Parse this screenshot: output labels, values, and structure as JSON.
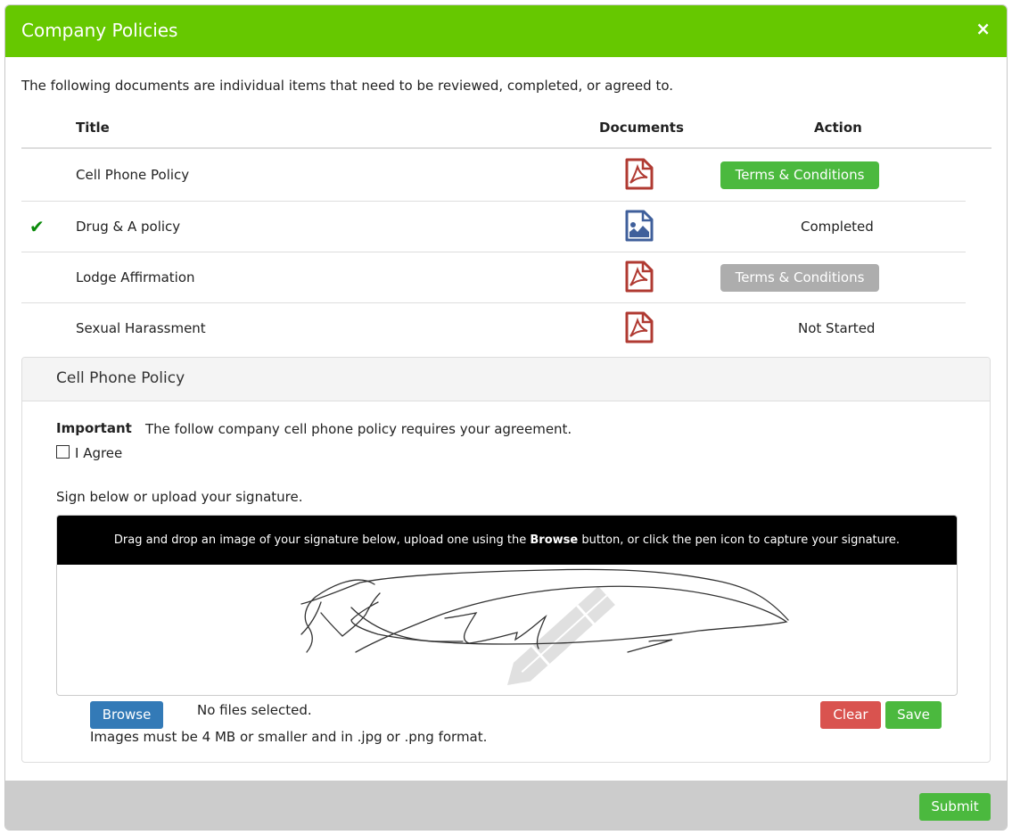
{
  "modal": {
    "title": "Company Policies",
    "close_label": "×",
    "intro": "The following documents are individual items that need to be reviewed, completed, or agreed to.",
    "table": {
      "headers": {
        "title": "Title",
        "documents": "Documents",
        "action": "Action"
      },
      "rows": [
        {
          "title": "Cell Phone Policy",
          "completed": false,
          "doc_icon": "pdf-icon",
          "action_type": "button-active",
          "action": "Terms & Conditions"
        },
        {
          "title": "Drug & A policy",
          "completed": true,
          "doc_icon": "image-file-icon",
          "action_type": "text",
          "action": "Completed"
        },
        {
          "title": "Lodge Affirmation",
          "completed": false,
          "doc_icon": "pdf-icon",
          "action_type": "button-disabled",
          "action": "Terms & Conditions"
        },
        {
          "title": "Sexual Harassment",
          "completed": false,
          "doc_icon": "pdf-icon",
          "action_type": "text",
          "action": "Not Started"
        }
      ]
    },
    "panel": {
      "title": "Cell Phone Policy",
      "important_label": "Important",
      "important_text": "The follow company cell phone policy requires your agreement.",
      "agree_label": "I Agree",
      "agree_checked": false,
      "sign_label": "Sign below or upload your signature.",
      "sig_bar": {
        "before": "Drag and drop an image of your signature below, upload one using the ",
        "bold": "Browse",
        "after": " button, or click the pen icon to capture your signature."
      },
      "browse_label": "Browse",
      "file_status": "No files selected.",
      "image_note": "Images must be 4 MB or smaller and in .jpg or .png format.",
      "clear_label": "Clear",
      "save_label": "Save"
    },
    "footer": {
      "submit_label": "Submit"
    }
  },
  "colors": {
    "header_green": "#66c800",
    "button_green": "#4bb93e",
    "button_gray": "#adadad",
    "button_blue": "#337ab7",
    "button_red": "#d9534f",
    "pdf_red": "#b03a32",
    "image_blue": "#3f5f9b",
    "check_green": "#0b8a0b",
    "footer_gray": "#cccccc"
  }
}
